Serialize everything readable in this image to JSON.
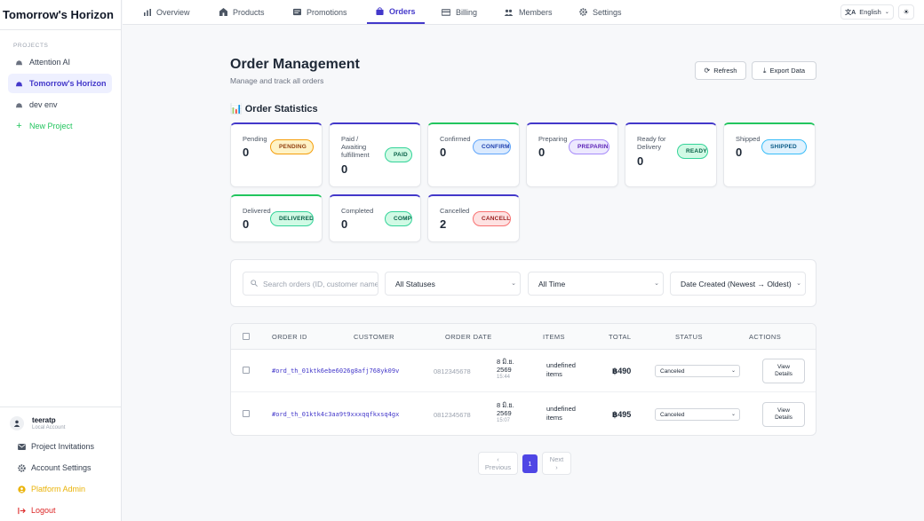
{
  "brand": "Tomorrow's Horizon",
  "sidebar": {
    "section": "PROJECTS",
    "projects": [
      {
        "label": "Attention AI"
      },
      {
        "label": "Tomorrow's Horizon"
      },
      {
        "label": "dev env"
      }
    ],
    "new_project": "New Project",
    "user": {
      "name": "teeratp",
      "role": "Local Account"
    },
    "bottom": [
      {
        "label": "Project Invitations",
        "icon": "mail-icon"
      },
      {
        "label": "Account Settings",
        "icon": "gear-icon"
      },
      {
        "label": "Platform Admin",
        "icon": "admin-icon"
      },
      {
        "label": "Logout",
        "icon": "logout-icon"
      }
    ]
  },
  "nav": {
    "items": [
      {
        "label": "Overview",
        "icon": "bar-chart-icon"
      },
      {
        "label": "Products",
        "icon": "store-icon"
      },
      {
        "label": "Promotions",
        "icon": "promotions-icon"
      },
      {
        "label": "Orders",
        "icon": "bag-icon"
      },
      {
        "label": "Billing",
        "icon": "billing-icon"
      },
      {
        "label": "Members",
        "icon": "members-icon"
      },
      {
        "label": "Settings",
        "icon": "gear-icon"
      }
    ],
    "active": "Orders",
    "language": "English",
    "theme_glyph": "☀"
  },
  "page": {
    "title": "Order Management",
    "subtitle": "Manage and track all orders",
    "refresh": "Refresh",
    "export": "Export Data",
    "stats_title": "📊 Order Statistics"
  },
  "stats": [
    {
      "label": "Pending",
      "count": "0",
      "badge": "PENDING",
      "accent": "#4338ca",
      "badge_bg": "#fef3c7",
      "badge_fg": "#92400e",
      "badge_border": "#f59e0b"
    },
    {
      "label": "Paid / Awaiting fulfillment",
      "count": "0",
      "badge": "PAID",
      "accent": "#4338ca",
      "badge_bg": "#d1fae5",
      "badge_fg": "#065f46",
      "badge_border": "#34d399"
    },
    {
      "label": "Confirmed",
      "count": "0",
      "badge": "CONFIRMED",
      "accent": "#22c55e",
      "badge_bg": "#dbeafe",
      "badge_fg": "#1e40af",
      "badge_border": "#60a5fa"
    },
    {
      "label": "Preparing",
      "count": "0",
      "badge": "PREPARING",
      "accent": "#4338ca",
      "badge_bg": "#ede9fe",
      "badge_fg": "#5b21b6",
      "badge_border": "#a78bfa"
    },
    {
      "label": "Ready for Delivery",
      "count": "0",
      "badge": "READY",
      "accent": "#4338ca",
      "badge_bg": "#d1fae5",
      "badge_fg": "#065f46",
      "badge_border": "#34d399"
    },
    {
      "label": "Shipped",
      "count": "0",
      "badge": "SHIPPED",
      "accent": "#22c55e",
      "badge_bg": "#e0f2fe",
      "badge_fg": "#075985",
      "badge_border": "#38bdf8"
    },
    {
      "label": "Delivered",
      "count": "0",
      "badge": "DELIVERED",
      "accent": "#22c55e",
      "badge_bg": "#d1fae5",
      "badge_fg": "#065f46",
      "badge_border": "#34d399"
    },
    {
      "label": "Completed",
      "count": "0",
      "badge": "COMPLETED",
      "accent": "#4338ca",
      "badge_bg": "#d1fae5",
      "badge_fg": "#065f46",
      "badge_border": "#34d399"
    },
    {
      "label": "Cancelled",
      "count": "2",
      "badge": "CANCELLED",
      "accent": "#4338ca",
      "badge_bg": "#fee2e2",
      "badge_fg": "#991b1b",
      "badge_border": "#f87171"
    }
  ],
  "filters": {
    "search_placeholder": "Search orders (ID, customer name...)",
    "status": "All Statuses",
    "time": "All Time",
    "sort": "Date Created (Newest → Oldest)"
  },
  "table": {
    "headers": [
      "ORDER ID",
      "CUSTOMER",
      "ORDER DATE",
      "ITEMS",
      "TOTAL",
      "STATUS",
      "ACTIONS"
    ],
    "rows": [
      {
        "id": "#ord_th_01ktk6ebe6026g8afj768yk09v",
        "customer": "0812345678",
        "date_1": "8 มิ.ย.",
        "date_2": "2569",
        "time": "15:44",
        "items_1": "undefined",
        "items_2": "items",
        "total": "฿490",
        "status": "Canceled",
        "action_1": "View",
        "action_2": "Details"
      },
      {
        "id": "#ord_th_01ktk4c3aa9t9xxxqqfkxsq4gx",
        "customer": "0812345678",
        "date_1": "8 มิ.ย.",
        "date_2": "2569",
        "time": "15:07",
        "items_1": "undefined",
        "items_2": "items",
        "total": "฿495",
        "status": "Canceled",
        "action_1": "View",
        "action_2": "Details"
      }
    ]
  },
  "pagination": {
    "prev_arrow": "‹",
    "prev": "Previous",
    "page": "1",
    "next": "Next",
    "next_arrow": "›"
  }
}
